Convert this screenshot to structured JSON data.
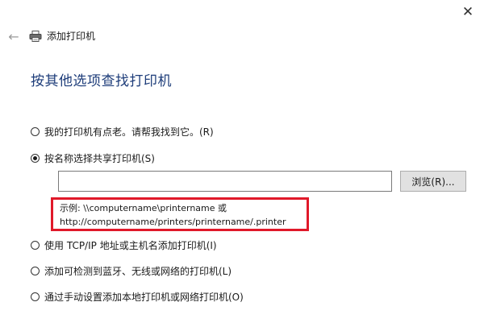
{
  "window": {
    "close_glyph": "✕",
    "back_glyph": "←",
    "title": "添加打印机"
  },
  "main": {
    "heading": "按其他选项查找打印机",
    "options": [
      {
        "label": "我的打印机有点老。请帮我找到它。(R)",
        "selected": false
      },
      {
        "label": "按名称选择共享打印机(S)",
        "selected": true
      },
      {
        "label": "使用 TCP/IP 地址或主机名添加打印机(I)",
        "selected": false
      },
      {
        "label": "添加可检测到蓝牙、无线或网络的打印机(L)",
        "selected": false
      },
      {
        "label": "通过手动设置添加本地打印机或网络打印机(O)",
        "selected": false
      }
    ],
    "share_name_input": {
      "value": "",
      "placeholder": ""
    },
    "browse_label": "浏览(R)...",
    "example_line1": "示例: \\\\computername\\printername 或",
    "example_line2": "http://computername/printers/printername/.printer"
  },
  "colors": {
    "heading": "#1e3d7a",
    "highlight_border": "#e0192a"
  }
}
